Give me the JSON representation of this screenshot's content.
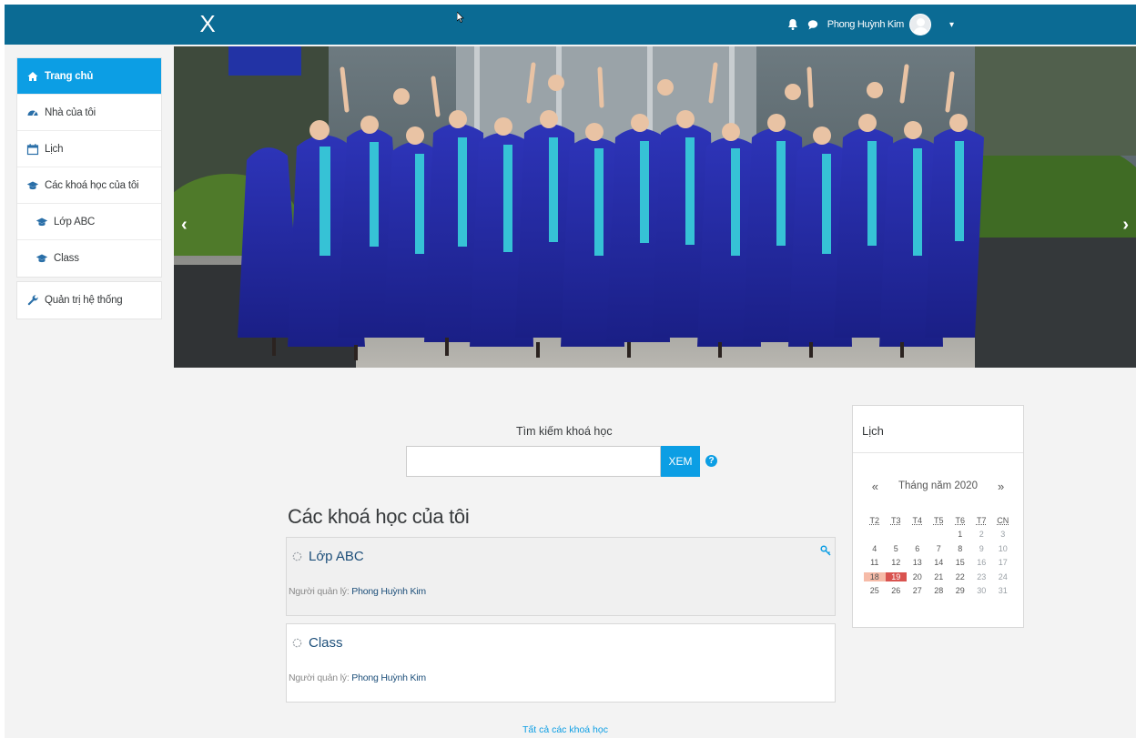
{
  "navbar": {
    "close_label": "X",
    "user_name": "Phong Huỳnh Kim",
    "icons": [
      "bell-icon",
      "chat-icon",
      "avatar",
      "caret-down-icon"
    ],
    "color": "#0b6b94"
  },
  "sidebar": {
    "items": [
      {
        "label": "Trang chủ",
        "icon": "home-icon",
        "active": true
      },
      {
        "label": "Nhà của tôi",
        "icon": "dashboard-icon"
      },
      {
        "label": "Lịch",
        "icon": "calendar-icon"
      },
      {
        "label": "Các khoá học của tôi",
        "icon": "graduation-cap-icon"
      },
      {
        "label": "Lớp ABC",
        "icon": "graduation-cap-icon"
      },
      {
        "label": "Class",
        "icon": "graduation-cap-icon"
      }
    ],
    "admin": {
      "label": "Quản trị hệ thống",
      "icon": "wrench-icon"
    },
    "active_color": "#0c9ee4"
  },
  "hero": {
    "prev_arrow": "‹",
    "next_arrow": "›"
  },
  "search": {
    "label": "Tìm kiếm khoá học",
    "value": "",
    "button": "XEM",
    "help": "?"
  },
  "courses": {
    "title": "Các khoá học của tôi",
    "items": [
      {
        "name": "Lớp ABC",
        "manager_label": "Người quản lý:",
        "manager": "Phong Huỳnh Kim"
      },
      {
        "name": "Class",
        "manager_label": "Người quản lý:",
        "manager": "Phong Huỳnh Kim"
      }
    ],
    "all_link": "Tất cả các khoá học"
  },
  "calendar": {
    "title": "Lịch",
    "prev": "«",
    "next": "»",
    "month": "Tháng năm 2020",
    "weekdays": [
      "T2",
      "T3",
      "T4",
      "T5",
      "T6",
      "T7",
      "CN"
    ],
    "weeks": [
      [
        "",
        "",
        "",
        "",
        "1",
        "2",
        "3"
      ],
      [
        "4",
        "5",
        "6",
        "7",
        "8",
        "9",
        "10"
      ],
      [
        "11",
        "12",
        "13",
        "14",
        "15",
        "16",
        "17"
      ],
      [
        "18",
        "19",
        "20",
        "21",
        "22",
        "23",
        "24"
      ],
      [
        "25",
        "26",
        "27",
        "28",
        "29",
        "30",
        "31"
      ]
    ],
    "highlight_light": "18",
    "highlight_today": "19"
  }
}
